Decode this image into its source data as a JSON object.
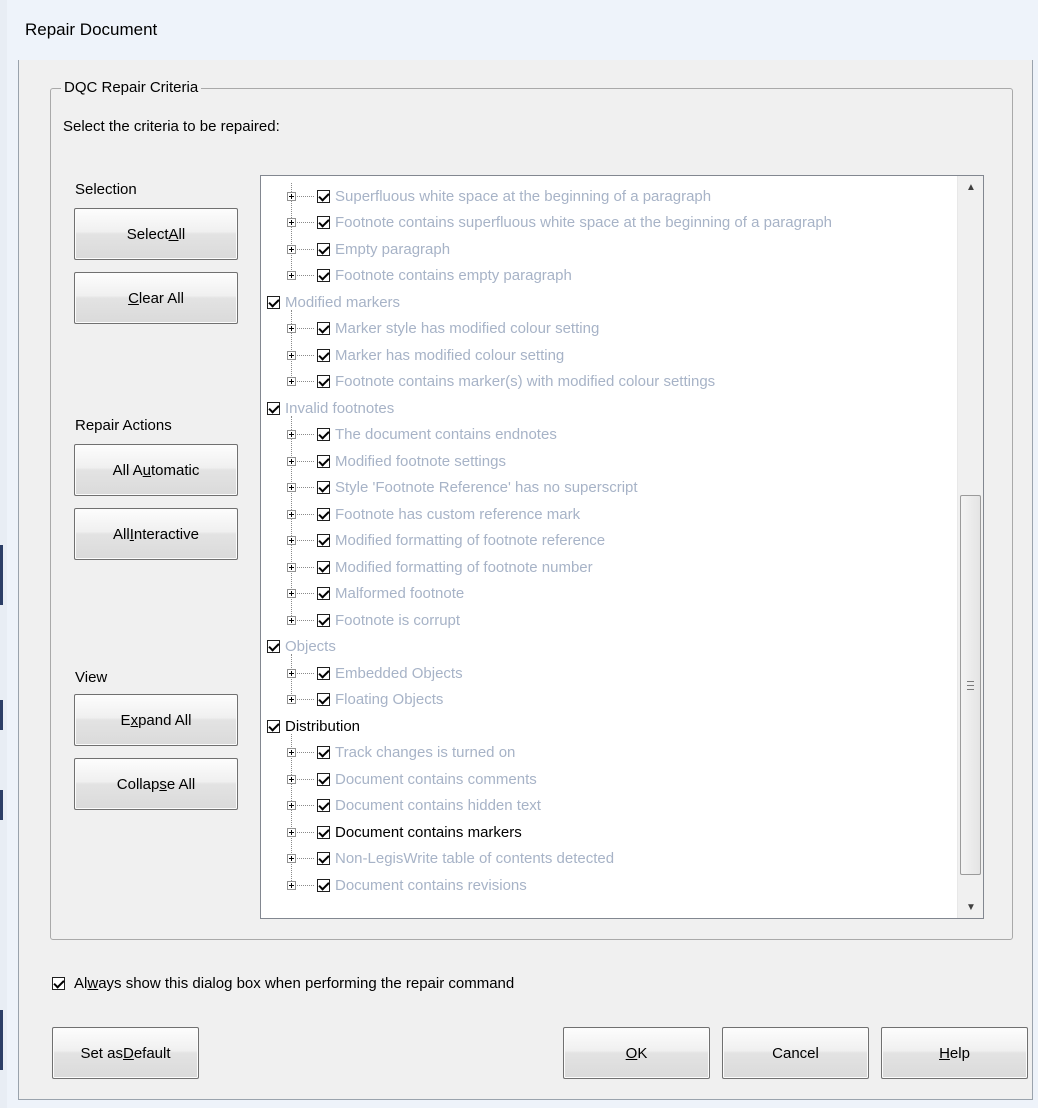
{
  "window": {
    "title": "Repair Document"
  },
  "group": {
    "title": "DQC Repair Criteria",
    "instruction": "Select the criteria to be repaired:"
  },
  "sections": {
    "selection": {
      "label": "Selection",
      "select_all": {
        "pre": "Select ",
        "u": "A",
        "post": "ll"
      },
      "clear_all": {
        "pre": "",
        "u": "C",
        "post": "lear All"
      }
    },
    "repair_actions": {
      "label": "Repair Actions",
      "all_automatic": {
        "pre": "All A",
        "u": "u",
        "post": "tomatic"
      },
      "all_interactive": {
        "pre": "All ",
        "u": "I",
        "post": "nteractive"
      }
    },
    "view": {
      "label": "View",
      "expand_all": {
        "pre": "E",
        "u": "x",
        "post": "pand All"
      },
      "collapse_all": {
        "pre": "Collap",
        "u": "s",
        "post": "e All"
      }
    }
  },
  "tree": {
    "items": [
      {
        "level": 1,
        "text": "Superfluous white space at the beginning of a paragraph",
        "checked": true,
        "enabled": false
      },
      {
        "level": 1,
        "text": "Footnote contains superfluous white space at the beginning of a paragraph",
        "checked": true,
        "enabled": false
      },
      {
        "level": 1,
        "text": "Empty paragraph",
        "checked": true,
        "enabled": false
      },
      {
        "level": 1,
        "text": "Footnote contains empty paragraph",
        "checked": true,
        "enabled": false
      },
      {
        "level": 0,
        "text": "Modified markers",
        "checked": true,
        "enabled": false
      },
      {
        "level": 1,
        "text": "Marker style has modified colour setting",
        "checked": true,
        "enabled": false
      },
      {
        "level": 1,
        "text": "Marker has modified colour setting",
        "checked": true,
        "enabled": false
      },
      {
        "level": 1,
        "text": "Footnote contains marker(s) with modified colour settings",
        "checked": true,
        "enabled": false
      },
      {
        "level": 0,
        "text": "Invalid footnotes",
        "checked": true,
        "enabled": false
      },
      {
        "level": 1,
        "text": "The document contains endnotes",
        "checked": true,
        "enabled": false
      },
      {
        "level": 1,
        "text": "Modified footnote settings",
        "checked": true,
        "enabled": false
      },
      {
        "level": 1,
        "text": "Style 'Footnote Reference' has no superscript",
        "checked": true,
        "enabled": false
      },
      {
        "level": 1,
        "text": "Footnote has custom reference mark",
        "checked": true,
        "enabled": false
      },
      {
        "level": 1,
        "text": "Modified formatting of footnote reference",
        "checked": true,
        "enabled": false
      },
      {
        "level": 1,
        "text": "Modified formatting of footnote number",
        "checked": true,
        "enabled": false
      },
      {
        "level": 1,
        "text": "Malformed footnote",
        "checked": true,
        "enabled": false
      },
      {
        "level": 1,
        "text": "Footnote is corrupt",
        "checked": true,
        "enabled": false
      },
      {
        "level": 0,
        "text": "Objects",
        "checked": true,
        "enabled": false
      },
      {
        "level": 1,
        "text": "Embedded Objects",
        "checked": true,
        "enabled": false
      },
      {
        "level": 1,
        "text": "Floating Objects",
        "checked": true,
        "enabled": false
      },
      {
        "level": 0,
        "text": "Distribution",
        "checked": true,
        "enabled": true
      },
      {
        "level": 1,
        "text": "Track changes is turned on",
        "checked": true,
        "enabled": false
      },
      {
        "level": 1,
        "text": "Document contains comments",
        "checked": true,
        "enabled": false
      },
      {
        "level": 1,
        "text": "Document contains hidden text",
        "checked": true,
        "enabled": false
      },
      {
        "level": 1,
        "text": "Document contains markers",
        "checked": true,
        "enabled": true
      },
      {
        "level": 1,
        "text": "Non-LegisWrite table of contents detected",
        "checked": true,
        "enabled": false
      },
      {
        "level": 1,
        "text": "Document contains revisions",
        "checked": true,
        "enabled": false
      }
    ],
    "scrollbar": {
      "up_icon": "arrow-up-icon",
      "down_icon": "arrow-down-icon",
      "grip_icon": "grip-icon"
    }
  },
  "always_show": {
    "checked": true,
    "pre": "Al",
    "u": "w",
    "post": "ays show this dialog box when performing the repair command"
  },
  "footer": {
    "set_default": {
      "pre": "Set as ",
      "u": "D",
      "post": "efault"
    },
    "ok": {
      "pre": "",
      "u": "O",
      "post": "K"
    },
    "cancel": "Cancel",
    "help": {
      "pre": "",
      "u": "H",
      "post": "elp"
    }
  }
}
